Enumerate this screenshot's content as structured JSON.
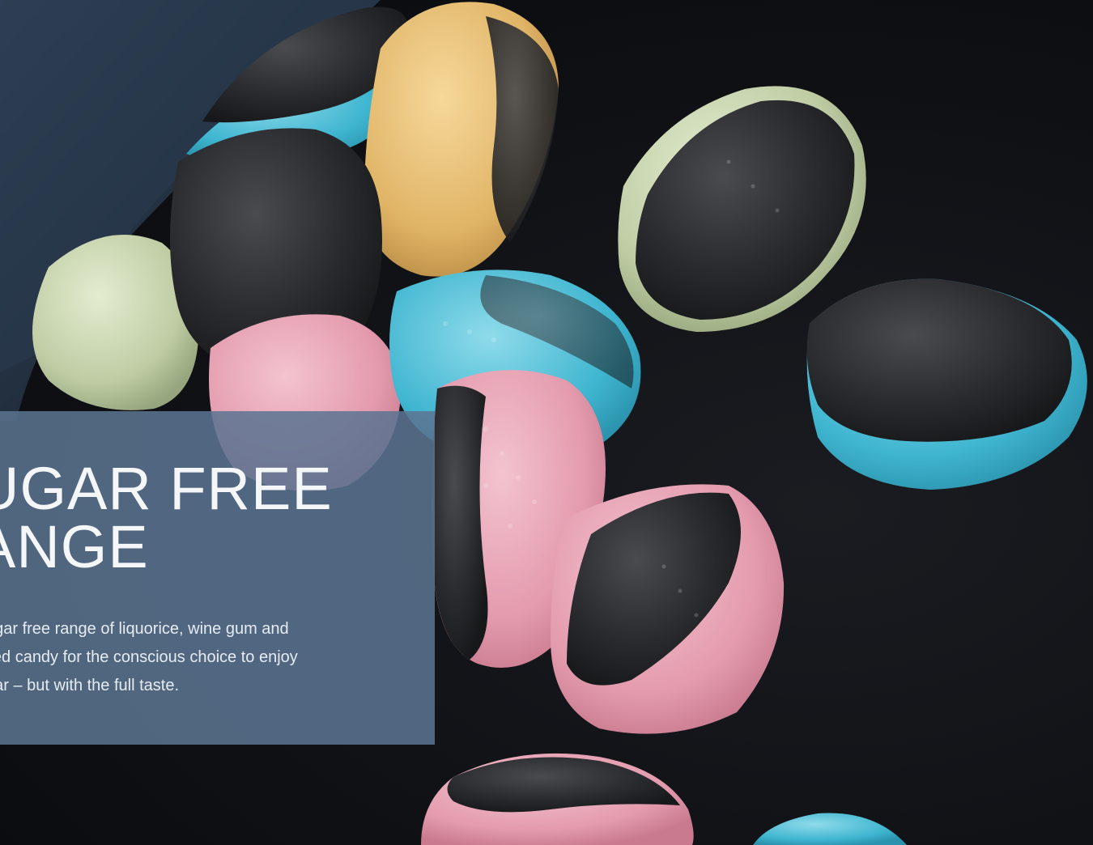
{
  "hero": {
    "image_description_icon": "candy-photo",
    "panel_color": "#5c7591",
    "title_lines": [
      "UGAR FREE",
      "ANGE"
    ],
    "body_lines": [
      "ugar free range of liquorice, wine gum and",
      "iled candy for the conscious choice to enjoy",
      "gar – but with the full taste."
    ]
  }
}
